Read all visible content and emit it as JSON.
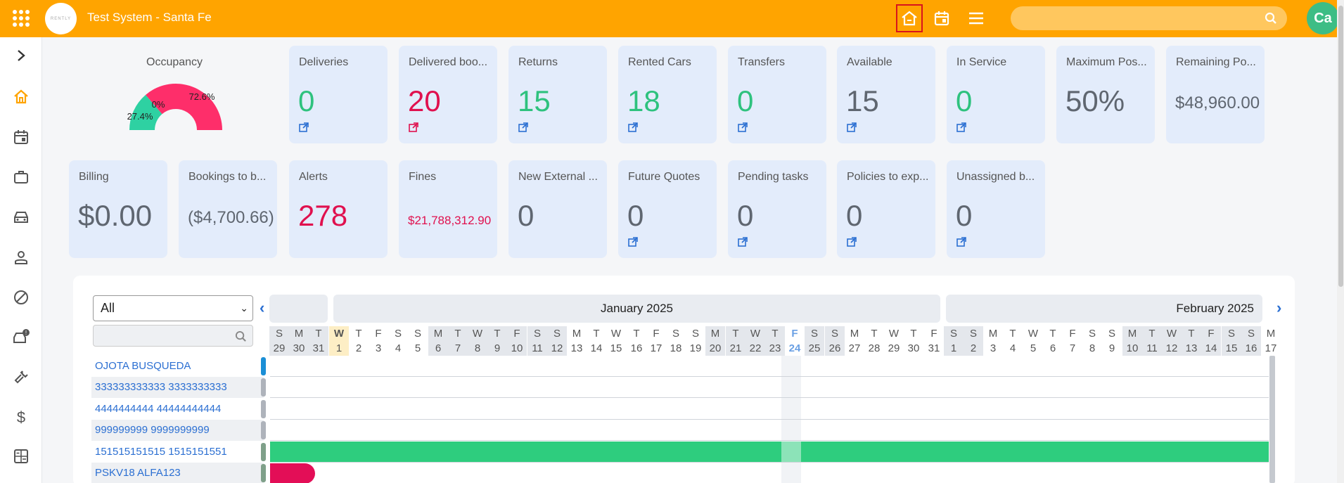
{
  "header": {
    "title": "Test System - Santa Fe",
    "logo_text": "RENTLY",
    "avatar_initials": "Ca",
    "search_placeholder": ""
  },
  "occupancy": {
    "title": "Occupancy",
    "segments": [
      {
        "label": "72.6%",
        "value": 72.6,
        "color": "#fe2e6a"
      },
      {
        "label": "27.4%",
        "value": 27.4,
        "color": "#2ed1a2"
      },
      {
        "label": "0%",
        "value": 0,
        "color": "#cccccc"
      }
    ]
  },
  "cards_row1": [
    {
      "label": "Deliveries",
      "value": "0",
      "color": "green",
      "link": true
    },
    {
      "label": "Delivered boo...",
      "value": "20",
      "color": "red",
      "link": true
    },
    {
      "label": "Returns",
      "value": "15",
      "color": "green",
      "link": true
    },
    {
      "label": "Rented Cars",
      "value": "18",
      "color": "green",
      "link": true
    },
    {
      "label": "Transfers",
      "value": "0",
      "color": "green",
      "link": true
    },
    {
      "label": "Available",
      "value": "15",
      "color": "grey",
      "link": true
    },
    {
      "label": "In Service",
      "value": "0",
      "color": "green",
      "link": true
    },
    {
      "label": "Maximum Pos...",
      "value": "50%",
      "color": "grey",
      "link": false
    },
    {
      "label": "Remaining Po...",
      "value": "$48,960.00",
      "color": "grey",
      "link": false
    }
  ],
  "cards_row2": [
    {
      "label": "Billing",
      "value": "$0.00",
      "color": "grey",
      "link": false
    },
    {
      "label": "Bookings to b...",
      "value": "($4,700.66)",
      "color": "grey",
      "link": false
    },
    {
      "label": "Alerts",
      "value": "278",
      "color": "red",
      "link": false
    },
    {
      "label": "Fines",
      "value": "$21,788,312.90",
      "color": "red",
      "link": false
    },
    {
      "label": "New External ...",
      "value": "0",
      "color": "grey",
      "link": false
    },
    {
      "label": "Future Quotes",
      "value": "0",
      "color": "grey",
      "link": true
    },
    {
      "label": "Pending tasks",
      "value": "0",
      "color": "grey",
      "link": true
    },
    {
      "label": "Policies to exp...",
      "value": "0",
      "color": "grey",
      "link": true
    },
    {
      "label": "Unassigned b...",
      "value": "0",
      "color": "grey",
      "link": true
    }
  ],
  "calendar": {
    "filter_value": "All",
    "months": [
      "January 2025",
      "February 2025"
    ],
    "days": [
      {
        "w": "S",
        "d": "29",
        "t": "weekend"
      },
      {
        "w": "M",
        "d": "30",
        "t": "weekend"
      },
      {
        "w": "T",
        "d": "31",
        "t": "weekend"
      },
      {
        "w": "W",
        "d": "1",
        "t": "today"
      },
      {
        "w": "T",
        "d": "2",
        "t": ""
      },
      {
        "w": "F",
        "d": "3",
        "t": ""
      },
      {
        "w": "S",
        "d": "4",
        "t": ""
      },
      {
        "w": "S",
        "d": "5",
        "t": ""
      },
      {
        "w": "M",
        "d": "6",
        "t": "weekend"
      },
      {
        "w": "T",
        "d": "7",
        "t": "weekend"
      },
      {
        "w": "W",
        "d": "8",
        "t": "weekend"
      },
      {
        "w": "T",
        "d": "9",
        "t": "weekend"
      },
      {
        "w": "F",
        "d": "10",
        "t": "weekend"
      },
      {
        "w": "S",
        "d": "11",
        "t": "weekend"
      },
      {
        "w": "S",
        "d": "12",
        "t": "weekend"
      },
      {
        "w": "M",
        "d": "13",
        "t": ""
      },
      {
        "w": "T",
        "d": "14",
        "t": ""
      },
      {
        "w": "W",
        "d": "15",
        "t": ""
      },
      {
        "w": "T",
        "d": "16",
        "t": ""
      },
      {
        "w": "F",
        "d": "17",
        "t": ""
      },
      {
        "w": "S",
        "d": "18",
        "t": ""
      },
      {
        "w": "S",
        "d": "19",
        "t": ""
      },
      {
        "w": "M",
        "d": "20",
        "t": "weekend"
      },
      {
        "w": "T",
        "d": "21",
        "t": "weekend"
      },
      {
        "w": "W",
        "d": "22",
        "t": "weekend"
      },
      {
        "w": "T",
        "d": "23",
        "t": "weekend"
      },
      {
        "w": "F",
        "d": "24",
        "t": "current"
      },
      {
        "w": "S",
        "d": "25",
        "t": "weekend"
      },
      {
        "w": "S",
        "d": "26",
        "t": "weekend"
      },
      {
        "w": "M",
        "d": "27",
        "t": ""
      },
      {
        "w": "T",
        "d": "28",
        "t": ""
      },
      {
        "w": "W",
        "d": "29",
        "t": ""
      },
      {
        "w": "T",
        "d": "30",
        "t": ""
      },
      {
        "w": "F",
        "d": "31",
        "t": ""
      },
      {
        "w": "S",
        "d": "1",
        "t": "weekend"
      },
      {
        "w": "S",
        "d": "2",
        "t": "weekend"
      },
      {
        "w": "M",
        "d": "3",
        "t": ""
      },
      {
        "w": "T",
        "d": "4",
        "t": ""
      },
      {
        "w": "W",
        "d": "5",
        "t": ""
      },
      {
        "w": "T",
        "d": "6",
        "t": ""
      },
      {
        "w": "F",
        "d": "7",
        "t": ""
      },
      {
        "w": "S",
        "d": "8",
        "t": ""
      },
      {
        "w": "S",
        "d": "9",
        "t": ""
      },
      {
        "w": "M",
        "d": "10",
        "t": "weekend"
      },
      {
        "w": "T",
        "d": "11",
        "t": "weekend"
      },
      {
        "w": "W",
        "d": "12",
        "t": "weekend"
      },
      {
        "w": "T",
        "d": "13",
        "t": "weekend"
      },
      {
        "w": "F",
        "d": "14",
        "t": "weekend"
      },
      {
        "w": "S",
        "d": "15",
        "t": "weekend"
      },
      {
        "w": "S",
        "d": "16",
        "t": "weekend"
      },
      {
        "w": "M",
        "d": "17",
        "t": ""
      }
    ],
    "rows": [
      {
        "label": "OJOTA BUSQUEDA",
        "tag_color": "#1b8fd6"
      },
      {
        "label": "333333333333 3333333333",
        "tag_color": "#aeb3bb"
      },
      {
        "label": "4444444444 44444444444",
        "tag_color": "#aeb3bb"
      },
      {
        "label": "999999999 9999999999",
        "tag_color": "#aeb3bb"
      },
      {
        "label": "151515151515 1515151551",
        "tag_color": "#7fa08a"
      },
      {
        "label": "PSKV18 ALFA123",
        "tag_color": "#7fa08a"
      }
    ],
    "booking_colors": {
      "active": "#2ecd7e",
      "reserved": "#e30e57"
    }
  }
}
